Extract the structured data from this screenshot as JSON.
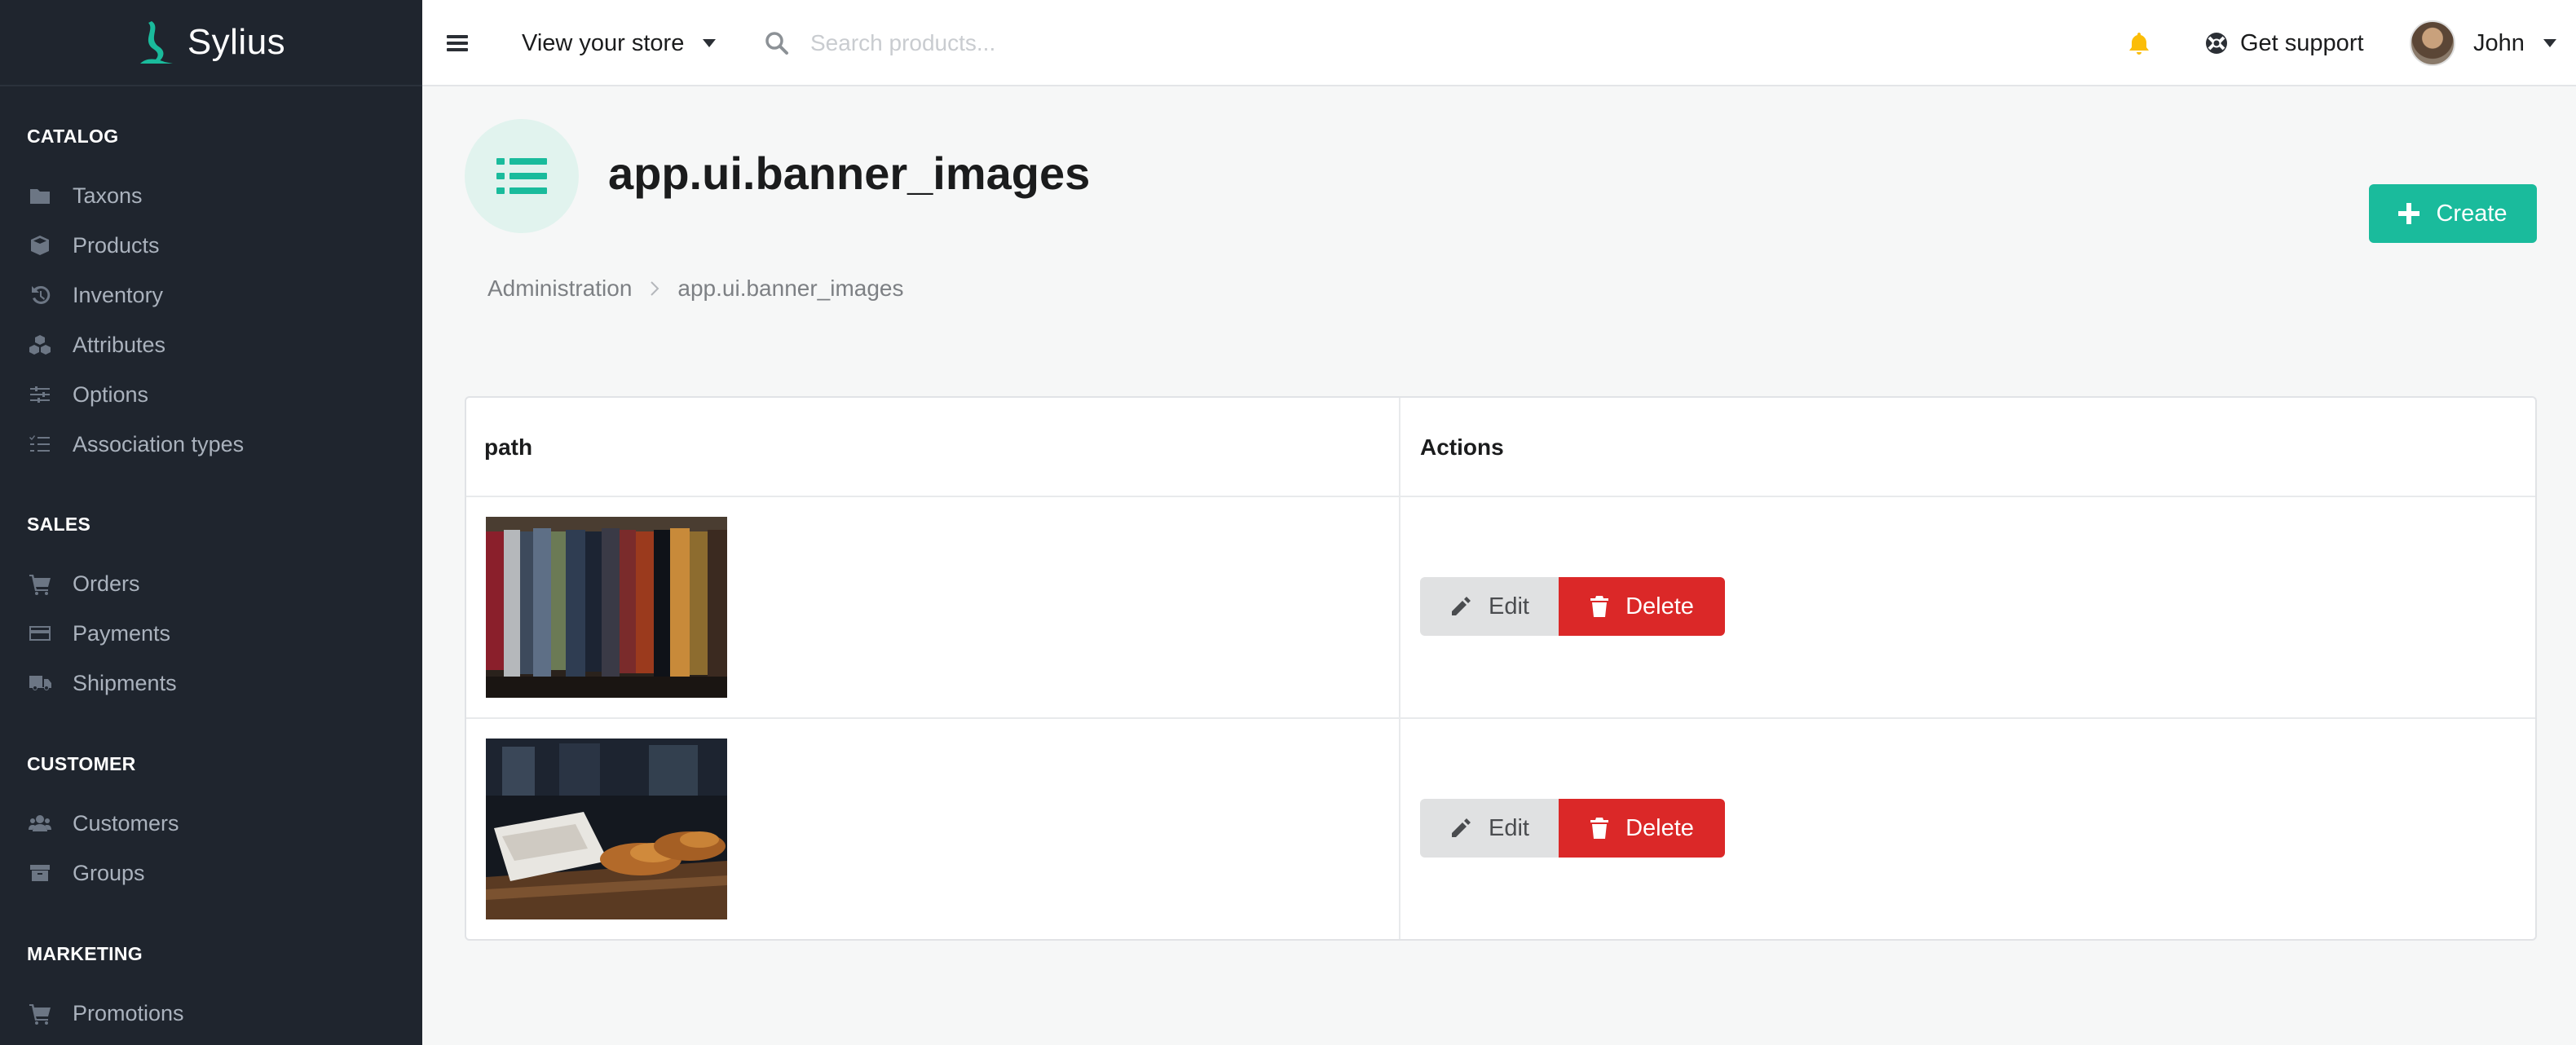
{
  "brand": {
    "name": "Sylius",
    "accent": "#1abb9c"
  },
  "sidebar": {
    "sections": [
      {
        "title": "CATALOG",
        "items": [
          {
            "label": "Taxons",
            "icon": "folder-icon"
          },
          {
            "label": "Products",
            "icon": "cube-icon"
          },
          {
            "label": "Inventory",
            "icon": "history-icon"
          },
          {
            "label": "Attributes",
            "icon": "cubes-icon"
          },
          {
            "label": "Options",
            "icon": "sliders-icon"
          },
          {
            "label": "Association types",
            "icon": "tasks-icon"
          }
        ]
      },
      {
        "title": "SALES",
        "items": [
          {
            "label": "Orders",
            "icon": "cart-icon"
          },
          {
            "label": "Payments",
            "icon": "credit-card-icon"
          },
          {
            "label": "Shipments",
            "icon": "truck-icon"
          }
        ]
      },
      {
        "title": "CUSTOMER",
        "items": [
          {
            "label": "Customers",
            "icon": "users-icon"
          },
          {
            "label": "Groups",
            "icon": "archive-icon"
          }
        ]
      },
      {
        "title": "MARKETING",
        "items": [
          {
            "label": "Promotions",
            "icon": "cart-icon"
          }
        ]
      }
    ]
  },
  "topbar": {
    "store_link": "View your store",
    "search_placeholder": "Search products...",
    "support": "Get support",
    "user_name": "John"
  },
  "page": {
    "title": "app.ui.banner_images",
    "create_label": "Create",
    "breadcrumb": {
      "root": "Administration",
      "current": "app.ui.banner_images"
    }
  },
  "table": {
    "headers": {
      "path": "path",
      "actions": "Actions"
    },
    "rows": [
      {
        "image": "clothing-rack-thumbnail",
        "edit_label": "Edit",
        "delete_label": "Delete"
      },
      {
        "image": "shoes-and-shirts-thumbnail",
        "edit_label": "Edit",
        "delete_label": "Delete"
      }
    ]
  },
  "colors": {
    "sidebar_bg": "#1f252e",
    "accent": "#1abb9c",
    "danger": "#db2828",
    "bell": "#fbbd08"
  }
}
